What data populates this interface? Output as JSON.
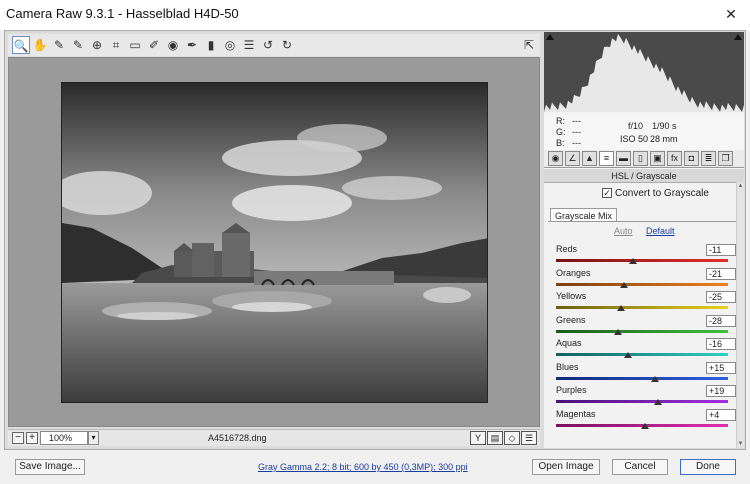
{
  "window": {
    "title": "Camera Raw 9.3.1  -  Hasselblad H4D-50",
    "close_glyph": "✕"
  },
  "toolbar": {
    "tools": [
      {
        "icon": "zoom-icon",
        "glyph": "🔍"
      },
      {
        "icon": "hand-icon",
        "glyph": "✋"
      },
      {
        "icon": "white-balance-icon",
        "glyph": "✎"
      },
      {
        "icon": "color-sampler-icon",
        "glyph": "✎"
      },
      {
        "icon": "target-adjust-icon",
        "glyph": "⊕"
      },
      {
        "icon": "crop-icon",
        "glyph": "⌗"
      },
      {
        "icon": "straighten-icon",
        "glyph": "▭"
      },
      {
        "icon": "spot-removal-icon",
        "glyph": "✐"
      },
      {
        "icon": "red-eye-icon",
        "glyph": "◉"
      },
      {
        "icon": "adjustment-brush-icon",
        "glyph": "✒"
      },
      {
        "icon": "graduated-filter-icon",
        "glyph": "▮"
      },
      {
        "icon": "radial-filter-icon",
        "glyph": "◎"
      },
      {
        "icon": "preferences-icon",
        "glyph": "☰"
      },
      {
        "icon": "rotate-ccw-icon",
        "glyph": "↺"
      },
      {
        "icon": "rotate-cw-icon",
        "glyph": "↻"
      }
    ],
    "fullscreen_glyph": "⇱"
  },
  "statusbar": {
    "zoom_out": "−",
    "zoom_in": "+",
    "zoom": "100%",
    "zoom_arrow": "▾",
    "filename": "A4516728.dng",
    "right_buttons": [
      "Y",
      "▤",
      "◇",
      "☰"
    ]
  },
  "readout": {
    "r_label": "R:",
    "r_value": "---",
    "g_label": "G:",
    "g_value": "---",
    "b_label": "B:",
    "b_value": "---",
    "aperture": "f/10",
    "shutter": "1/90 s",
    "iso": "ISO 50",
    "focal": "28 mm"
  },
  "panel_tabs": [
    {
      "icon": "basic-tab-icon",
      "glyph": "◉"
    },
    {
      "icon": "tone-curve-tab-icon",
      "glyph": "∠"
    },
    {
      "icon": "detail-tab-icon",
      "glyph": "▲"
    },
    {
      "icon": "hsl-tab-icon",
      "glyph": "≡"
    },
    {
      "icon": "split-toning-tab-icon",
      "glyph": "▬"
    },
    {
      "icon": "lens-tab-icon",
      "glyph": "▯"
    },
    {
      "icon": "effects-tab-icon",
      "glyph": "▣"
    },
    {
      "icon": "fx-tab-icon",
      "glyph": "fx"
    },
    {
      "icon": "camera-calibration-tab-icon",
      "glyph": "◘"
    },
    {
      "icon": "presets-tab-icon",
      "glyph": "≣"
    },
    {
      "icon": "snapshots-tab-icon",
      "glyph": "❐"
    }
  ],
  "panel": {
    "header": "HSL / Grayscale",
    "convert_label": "Convert to Grayscale",
    "convert_checked": true,
    "check_glyph": "✓",
    "subtab": "Grayscale Mix",
    "auto": "Auto",
    "default": "Default"
  },
  "sliders": [
    {
      "label": "Reds",
      "value": "-11",
      "amount": -11,
      "colors": [
        "#7a1010",
        "#e03030"
      ]
    },
    {
      "label": "Oranges",
      "value": "-21",
      "amount": -21,
      "colors": [
        "#7a4010",
        "#f08020"
      ]
    },
    {
      "label": "Yellows",
      "value": "-25",
      "amount": -25,
      "colors": [
        "#6a6010",
        "#e8d020"
      ]
    },
    {
      "label": "Greens",
      "value": "-28",
      "amount": -28,
      "colors": [
        "#1a5a1a",
        "#40c040"
      ]
    },
    {
      "label": "Aquas",
      "value": "-16",
      "amount": -16,
      "colors": [
        "#106060",
        "#30d0c0"
      ]
    },
    {
      "label": "Blues",
      "value": "+15",
      "amount": 15,
      "colors": [
        "#102a7a",
        "#3060e0"
      ]
    },
    {
      "label": "Purples",
      "value": "+19",
      "amount": 19,
      "colors": [
        "#4a107a",
        "#a030e0"
      ]
    },
    {
      "label": "Magentas",
      "value": "+4",
      "amount": 4,
      "colors": [
        "#7a1060",
        "#e030b0"
      ]
    }
  ],
  "scroll_up": "▲",
  "scroll_down": "▼",
  "footer": {
    "save_image": "Save Image...",
    "info_link": "Gray Gamma 2.2; 8 bit; 600 by 450 (0,3MP); 300 ppi",
    "open_image": "Open Image",
    "cancel": "Cancel",
    "done": "Done"
  }
}
